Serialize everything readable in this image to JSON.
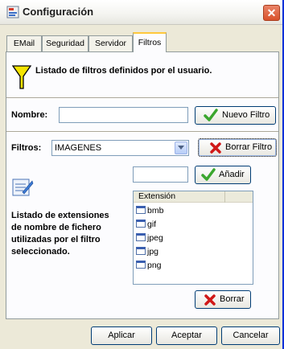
{
  "window": {
    "title": "Configuración"
  },
  "tabs": [
    {
      "label": "EMail"
    },
    {
      "label": "Seguridad"
    },
    {
      "label": "Servidor"
    },
    {
      "label": "Filtros"
    }
  ],
  "filtros": {
    "heading": "Listado de filtros definidos por el usuario.",
    "nombre_label": "Nombre:",
    "nombre_value": "",
    "nuevo_button": "Nuevo Filtro",
    "filtros_label": "Filtros:",
    "filtros_selected": "IMAGENES",
    "borrar_filtro_button": "Borrar Filtro",
    "extension_input_value": "",
    "anadir_button": "Añadir",
    "description": "Listado de extensiones de nombre de fichero utilizadas por el filtro seleccionado.",
    "description_lines": [
      "Listado de extensiones",
      "de nombre de fichero",
      "utilizadas por el filtro",
      "seleccionado."
    ],
    "list_header": "Extensión",
    "extensions": [
      "bmb",
      "gif",
      "jpeg",
      "jpg",
      "png"
    ],
    "borrar_button": "Borrar"
  },
  "footer": {
    "aplicar": "Aplicar",
    "aceptar": "Aceptar",
    "cancelar": "Cancelar"
  },
  "colors": {
    "check_green": "#3aa62e",
    "cross_red": "#d01818",
    "funnel_yellow": "#f5e400"
  }
}
